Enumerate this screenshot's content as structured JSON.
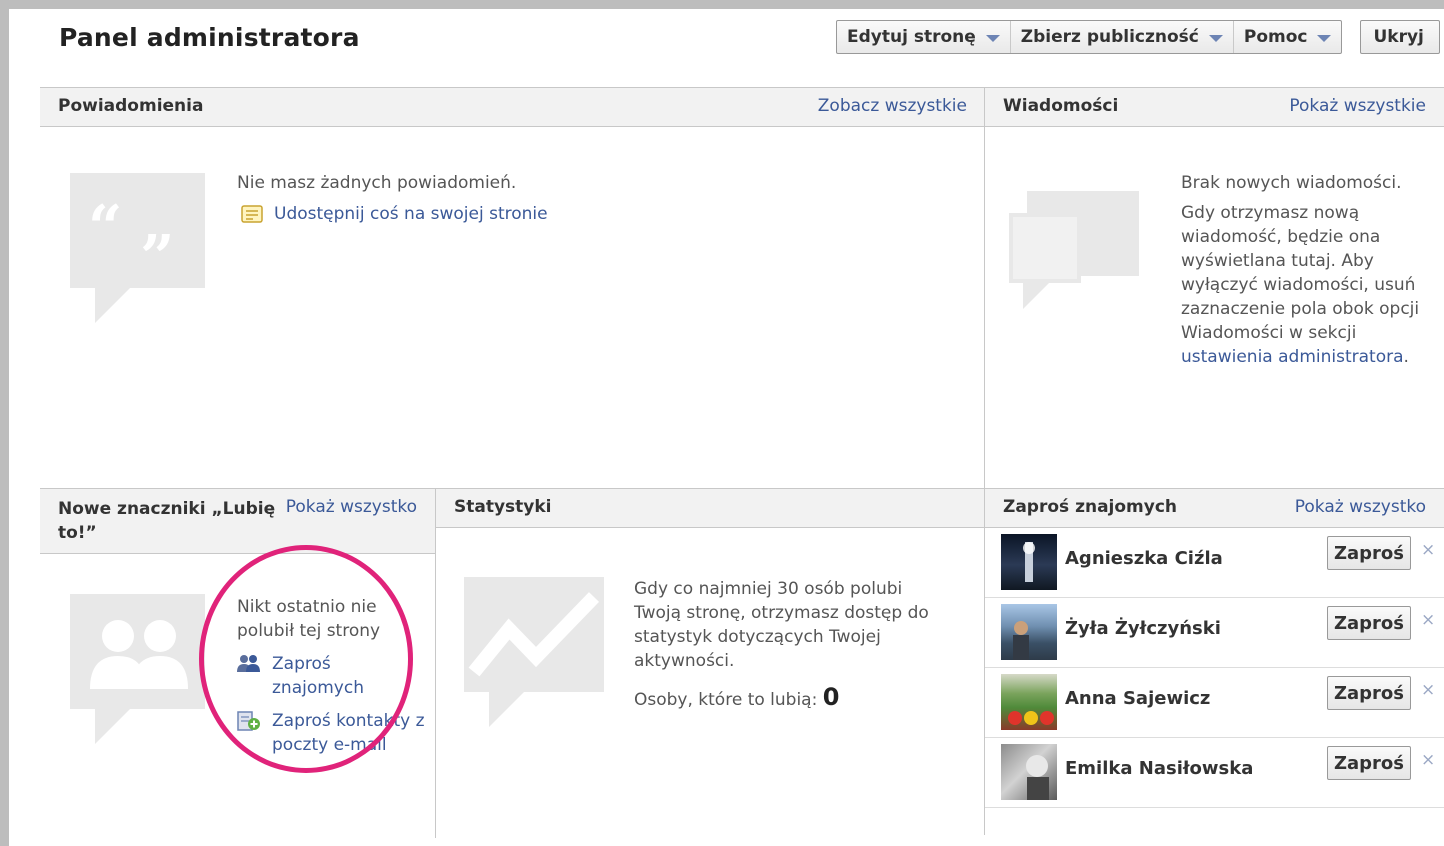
{
  "header": {
    "title": "Panel administratora",
    "actions": [
      {
        "label": "Edytuj stronę"
      },
      {
        "label": "Zbierz publiczność"
      },
      {
        "label": "Pomoc"
      }
    ],
    "hide_label": "Ukryj"
  },
  "notifications": {
    "title": "Powiadomienia",
    "link": "Zobacz wszystkie",
    "empty_text": "Nie masz żadnych powiadomień.",
    "share_link": "Udostępnij coś na swojej stronie"
  },
  "messages": {
    "title": "Wiadomości",
    "link": "Pokaż wszystkie",
    "empty_title": "Brak nowych wiadomości.",
    "description": "Gdy otrzymasz nową wiadomość, będzie ona wyświetlana tutaj. Aby wyłączyć wiadomości, usuń zaznaczenie pola obok opcji Wiadomości w sekcji",
    "settings_link": "ustawienia administratora",
    "period": "."
  },
  "likes": {
    "title": "Nowe znaczniki „Lubię to!”",
    "link": "Pokaż wszystko",
    "empty_text": "Nikt ostatnio nie polubił tej strony",
    "invite_friends": "Zaproś znajomych",
    "invite_email": "Zaproś kontakty z poczty e-mail"
  },
  "stats": {
    "title": "Statystyki",
    "description": "Gdy co najmniej 30 osób polubi Twoją stronę, otrzymasz dostęp do statystyk dotyczących Twojej aktywności.",
    "likes_label": "Osoby, które to lubią:",
    "likes_count": "0"
  },
  "invite": {
    "title": "Zaproś znajomych",
    "link": "Pokaż wszystko",
    "button_label": "Zaproś",
    "close_glyph": "×",
    "people": [
      {
        "name": "Agnieszka Ciźla"
      },
      {
        "name": "Żyła Żyłczyński"
      },
      {
        "name": "Anna Sajewicz"
      },
      {
        "name": "Emilka Nasiłowska"
      }
    ]
  },
  "colors": {
    "link": "#3b5998",
    "highlight_circle": "#e0237a"
  }
}
